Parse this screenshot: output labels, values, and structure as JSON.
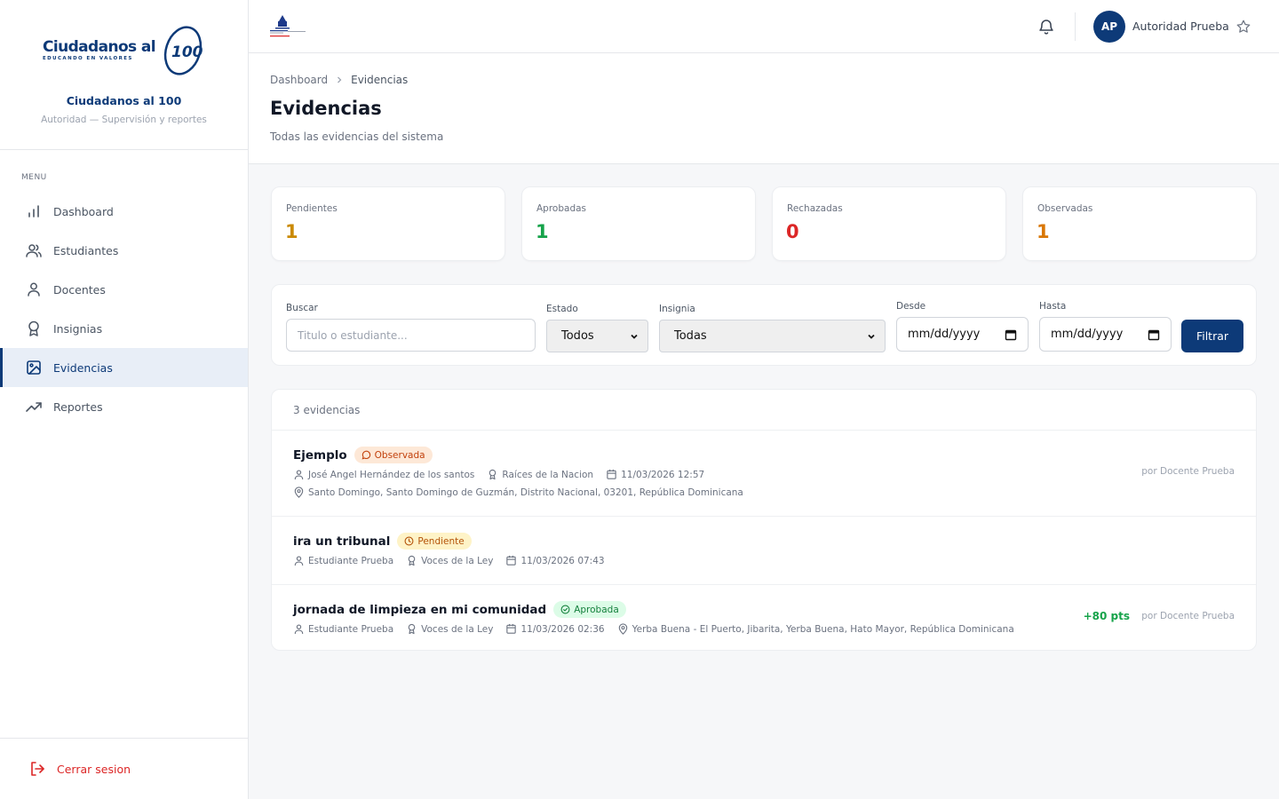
{
  "brand": {
    "logo_main": "Ciudadanos al",
    "logo_number": "100",
    "logo_sub": "EDUCANDO EN VALORES",
    "name": "Ciudadanos al 100",
    "desc": "Autoridad — Supervisión y reportes"
  },
  "sidebar": {
    "menu_label": "MENU",
    "items": [
      {
        "label": "Dashboard",
        "icon": "bar-chart-icon"
      },
      {
        "label": "Estudiantes",
        "icon": "users-icon"
      },
      {
        "label": "Docentes",
        "icon": "user-icon"
      },
      {
        "label": "Insignias",
        "icon": "award-icon"
      },
      {
        "label": "Evidencias",
        "icon": "image-icon",
        "active": true
      },
      {
        "label": "Reportes",
        "icon": "trending-up-icon"
      }
    ],
    "logout_label": "Cerrar sesion"
  },
  "topbar": {
    "avatar_initials": "AP",
    "user_name": "Autoridad Prueba"
  },
  "header": {
    "breadcrumb": [
      "Dashboard",
      "Evidencias"
    ],
    "title": "Evidencias",
    "subtitle": "Todas las evidencias del sistema"
  },
  "stats": [
    {
      "label": "Pendientes",
      "value": "1",
      "color": "#ca8a04"
    },
    {
      "label": "Aprobadas",
      "value": "1",
      "color": "#16a34a"
    },
    {
      "label": "Rechazadas",
      "value": "0",
      "color": "#dc2626"
    },
    {
      "label": "Observadas",
      "value": "1",
      "color": "#d97706"
    }
  ],
  "filters": {
    "search_label": "Buscar",
    "search_placeholder": "Titulo o estudiante...",
    "estado_label": "Estado",
    "estado_value": "Todos",
    "insignia_label": "Insignia",
    "insignia_value": "Todas",
    "desde_label": "Desde",
    "desde_value": "mm/dd/yyyy",
    "hasta_label": "Hasta",
    "hasta_value": "mm/dd/yyyy",
    "button_label": "Filtrar"
  },
  "list": {
    "count_label": "3 evidencias",
    "rows": [
      {
        "title": "Ejemplo",
        "status": "Observada",
        "student": "José Angel Hernández de los santos",
        "badge": "Raíces de la Nacion",
        "date": "11/03/2026 12:57",
        "location": "Santo Domingo, Santo Domingo de Guzmán, Distrito Nacional, 03201, República Dominicana",
        "by": "por Docente Prueba"
      },
      {
        "title": "ira un tribunal",
        "status": "Pendiente",
        "student": "Estudiante Prueba",
        "badge": "Voces de la Ley",
        "date": "11/03/2026 07:43"
      },
      {
        "title": "jornada de limpieza en mi comunidad",
        "status": "Aprobada",
        "student": "Estudiante Prueba",
        "badge": "Voces de la Ley",
        "date": "11/03/2026 02:36",
        "location": "Yerba Buena - El Puerto, Jibarita, Yerba Buena, Hato Mayor, República Dominicana",
        "points": "+80 pts",
        "by": "por Docente Prueba"
      }
    ]
  }
}
